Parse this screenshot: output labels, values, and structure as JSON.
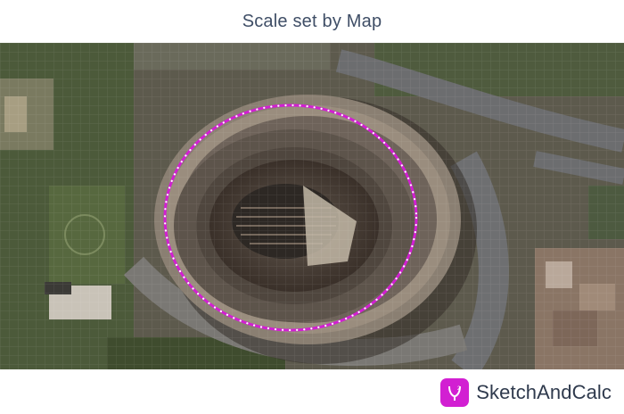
{
  "header": {
    "title": "Scale set by Map"
  },
  "map": {
    "layer": "satellite imagery",
    "shape": "ellipse-measurement"
  },
  "brand": {
    "name": "SketchAndCalc",
    "logo_icon": "sketchandcalc-logo-icon"
  },
  "colors": {
    "accent": "#d21fd2",
    "title_text": "#3f4e66",
    "brand_text": "#2f3a4d",
    "shape_dots": "#ffffff"
  }
}
